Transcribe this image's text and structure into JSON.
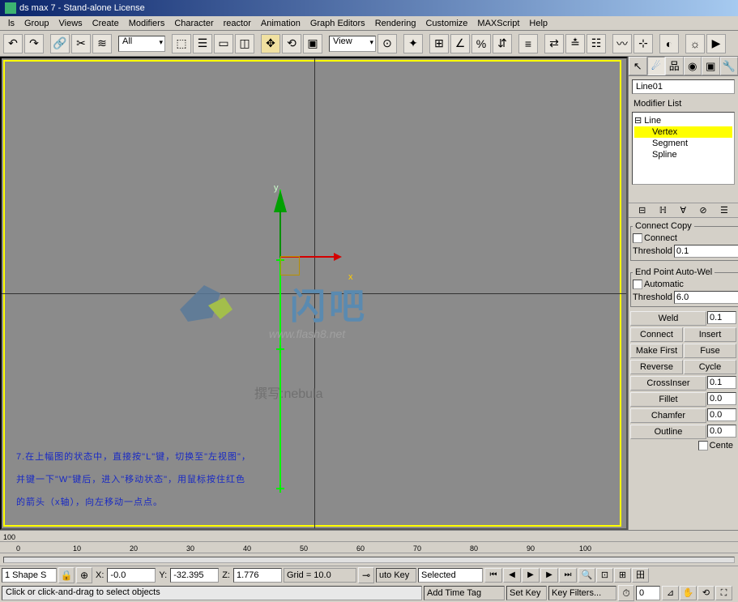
{
  "title": "ds max 7 - Stand-alone License",
  "menu": [
    "ls",
    "Group",
    "Views",
    "Create",
    "Modifiers",
    "Character",
    "reactor",
    "Animation",
    "Graph Editors",
    "Rendering",
    "Customize",
    "MAXScript",
    "Help"
  ],
  "toolbar": {
    "sel_filter": "All",
    "refcoord": "View"
  },
  "viewport": {
    "watermark_text": "闪吧",
    "watermark_url": "www.flash8.net",
    "author": "撰写:nebula",
    "instruction_l1": "7.在上幅图的状态中，直接按\"L\"键，切换至\"左视图\"，",
    "instruction_l2": "并键一下\"W\"键后，进入\"移动状态\"，用鼠标按住红色",
    "instruction_l3": "的箭头（x轴），向左移动一点点。",
    "axis_x": "x",
    "axis_y": "y"
  },
  "ruler_left": "100",
  "ruler_ticks": [
    "0",
    "10",
    "20",
    "30",
    "40",
    "50",
    "60",
    "70",
    "80",
    "90",
    "100"
  ],
  "panel": {
    "object_name": "Line01",
    "modifier_label": "Modifier List",
    "tree_root": "⊟ Line",
    "tree_sub": [
      "Vertex",
      "Segment",
      "Spline"
    ],
    "connect_group": "Connect Copy",
    "connect_chk": "Connect",
    "threshold_label": "Threshold",
    "threshold_val": "0.1",
    "endpoint_group": "End Point Auto-Wel",
    "automatic": "Automatic",
    "threshold2_val": "6.0",
    "btn_weld": "Weld",
    "weld_val": "0.1",
    "btn_connect": "Connect",
    "btn_insert": "Insert",
    "btn_makefirst": "Make First",
    "btn_fuse": "Fuse",
    "btn_reverse": "Reverse",
    "btn_cycle": "Cycle",
    "btn_crossins": "CrossInser",
    "crossins_val": "0.1",
    "btn_fillet": "Fillet",
    "fillet_val": "0.0",
    "btn_chamfer": "Chamfer",
    "chamfer_val": "0.0",
    "btn_outline": "Outline",
    "outline_val": "0.0",
    "cente": "Cente"
  },
  "status": {
    "selection": "1 Shape S",
    "x": "-0.0",
    "y": "-32.395",
    "z": "1.776",
    "grid": "Grid = 10.0",
    "autokey": "uto Key",
    "selected_mode": "Selected",
    "setkey": "Set Key",
    "filters": "Key Filters...",
    "addtag": "Add Time Tag",
    "prompt": "Click or click-and-drag to select objects"
  }
}
